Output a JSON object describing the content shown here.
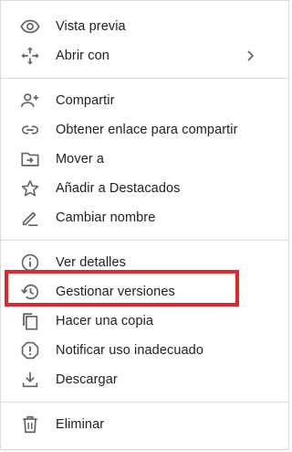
{
  "menu": {
    "groups": [
      {
        "items": [
          {
            "label": "Vista previa",
            "icon": "eye-icon"
          },
          {
            "label": "Abrir con",
            "icon": "move-arrows-icon",
            "submenu": true
          }
        ]
      },
      {
        "items": [
          {
            "label": "Compartir",
            "icon": "add-person-icon"
          },
          {
            "label": "Obtener enlace para compartir",
            "icon": "link-icon"
          },
          {
            "label": "Mover a",
            "icon": "folder-move-icon"
          },
          {
            "label": "Añadir a Destacados",
            "icon": "star-outline-icon"
          },
          {
            "label": "Cambiar nombre",
            "icon": "pencil-icon"
          }
        ]
      },
      {
        "items": [
          {
            "label": "Ver detalles",
            "icon": "info-icon"
          },
          {
            "label": "Gestionar versiones",
            "icon": "history-icon"
          },
          {
            "label": "Hacer una copia",
            "icon": "copy-icon"
          },
          {
            "label": "Notificar uso inadecuado",
            "icon": "report-icon"
          },
          {
            "label": "Descargar",
            "icon": "download-icon"
          }
        ]
      },
      {
        "items": [
          {
            "label": "Eliminar",
            "icon": "trash-icon"
          }
        ]
      }
    ]
  },
  "colors": {
    "icon": "#5f6368",
    "text": "#202124",
    "divider": "#dadce0",
    "highlight_border": "#e2262b"
  }
}
